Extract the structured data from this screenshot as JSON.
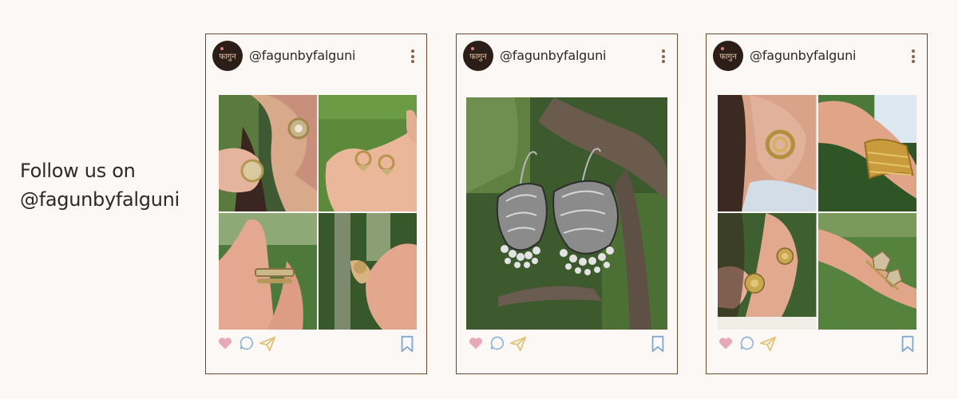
{
  "follow": {
    "line1": "Follow us on",
    "line2": "@fagunbyfalguni"
  },
  "posts": [
    {
      "handle": "@fagunbyfalguni",
      "avatar_text": "फागुन",
      "layout": "grid",
      "tiles": [
        "gold-stud-earring-on-ear",
        "gold-hoop-earrings-in-hand",
        "gold-ring-on-finger",
        "gold-floral-ring-in-hand"
      ]
    },
    {
      "handle": "@fagunbyfalguni",
      "avatar_text": "फागुन",
      "layout": "single",
      "tiles": [
        "silver-jhumka-earrings-on-branch"
      ]
    },
    {
      "handle": "@fagunbyfalguni",
      "avatar_text": "फागुन",
      "layout": "grid",
      "tiles": [
        "gold-spiral-earring-on-ear",
        "gold-cuff-bracelet-on-wrist",
        "gold-flower-earrings",
        "gold-floral-bracelet-on-wrist"
      ]
    }
  ],
  "colors": {
    "background": "#fcf8f5",
    "border": "#6b4a2e",
    "heart": "#e7a9b8",
    "comment": "#8fb6d8",
    "share": "#e3c27a",
    "bookmark": "#7fa8d6"
  },
  "icons": {
    "like": "heart-icon",
    "comment": "comment-icon",
    "share": "send-icon",
    "save": "bookmark-icon",
    "more": "more-vertical-icon"
  }
}
